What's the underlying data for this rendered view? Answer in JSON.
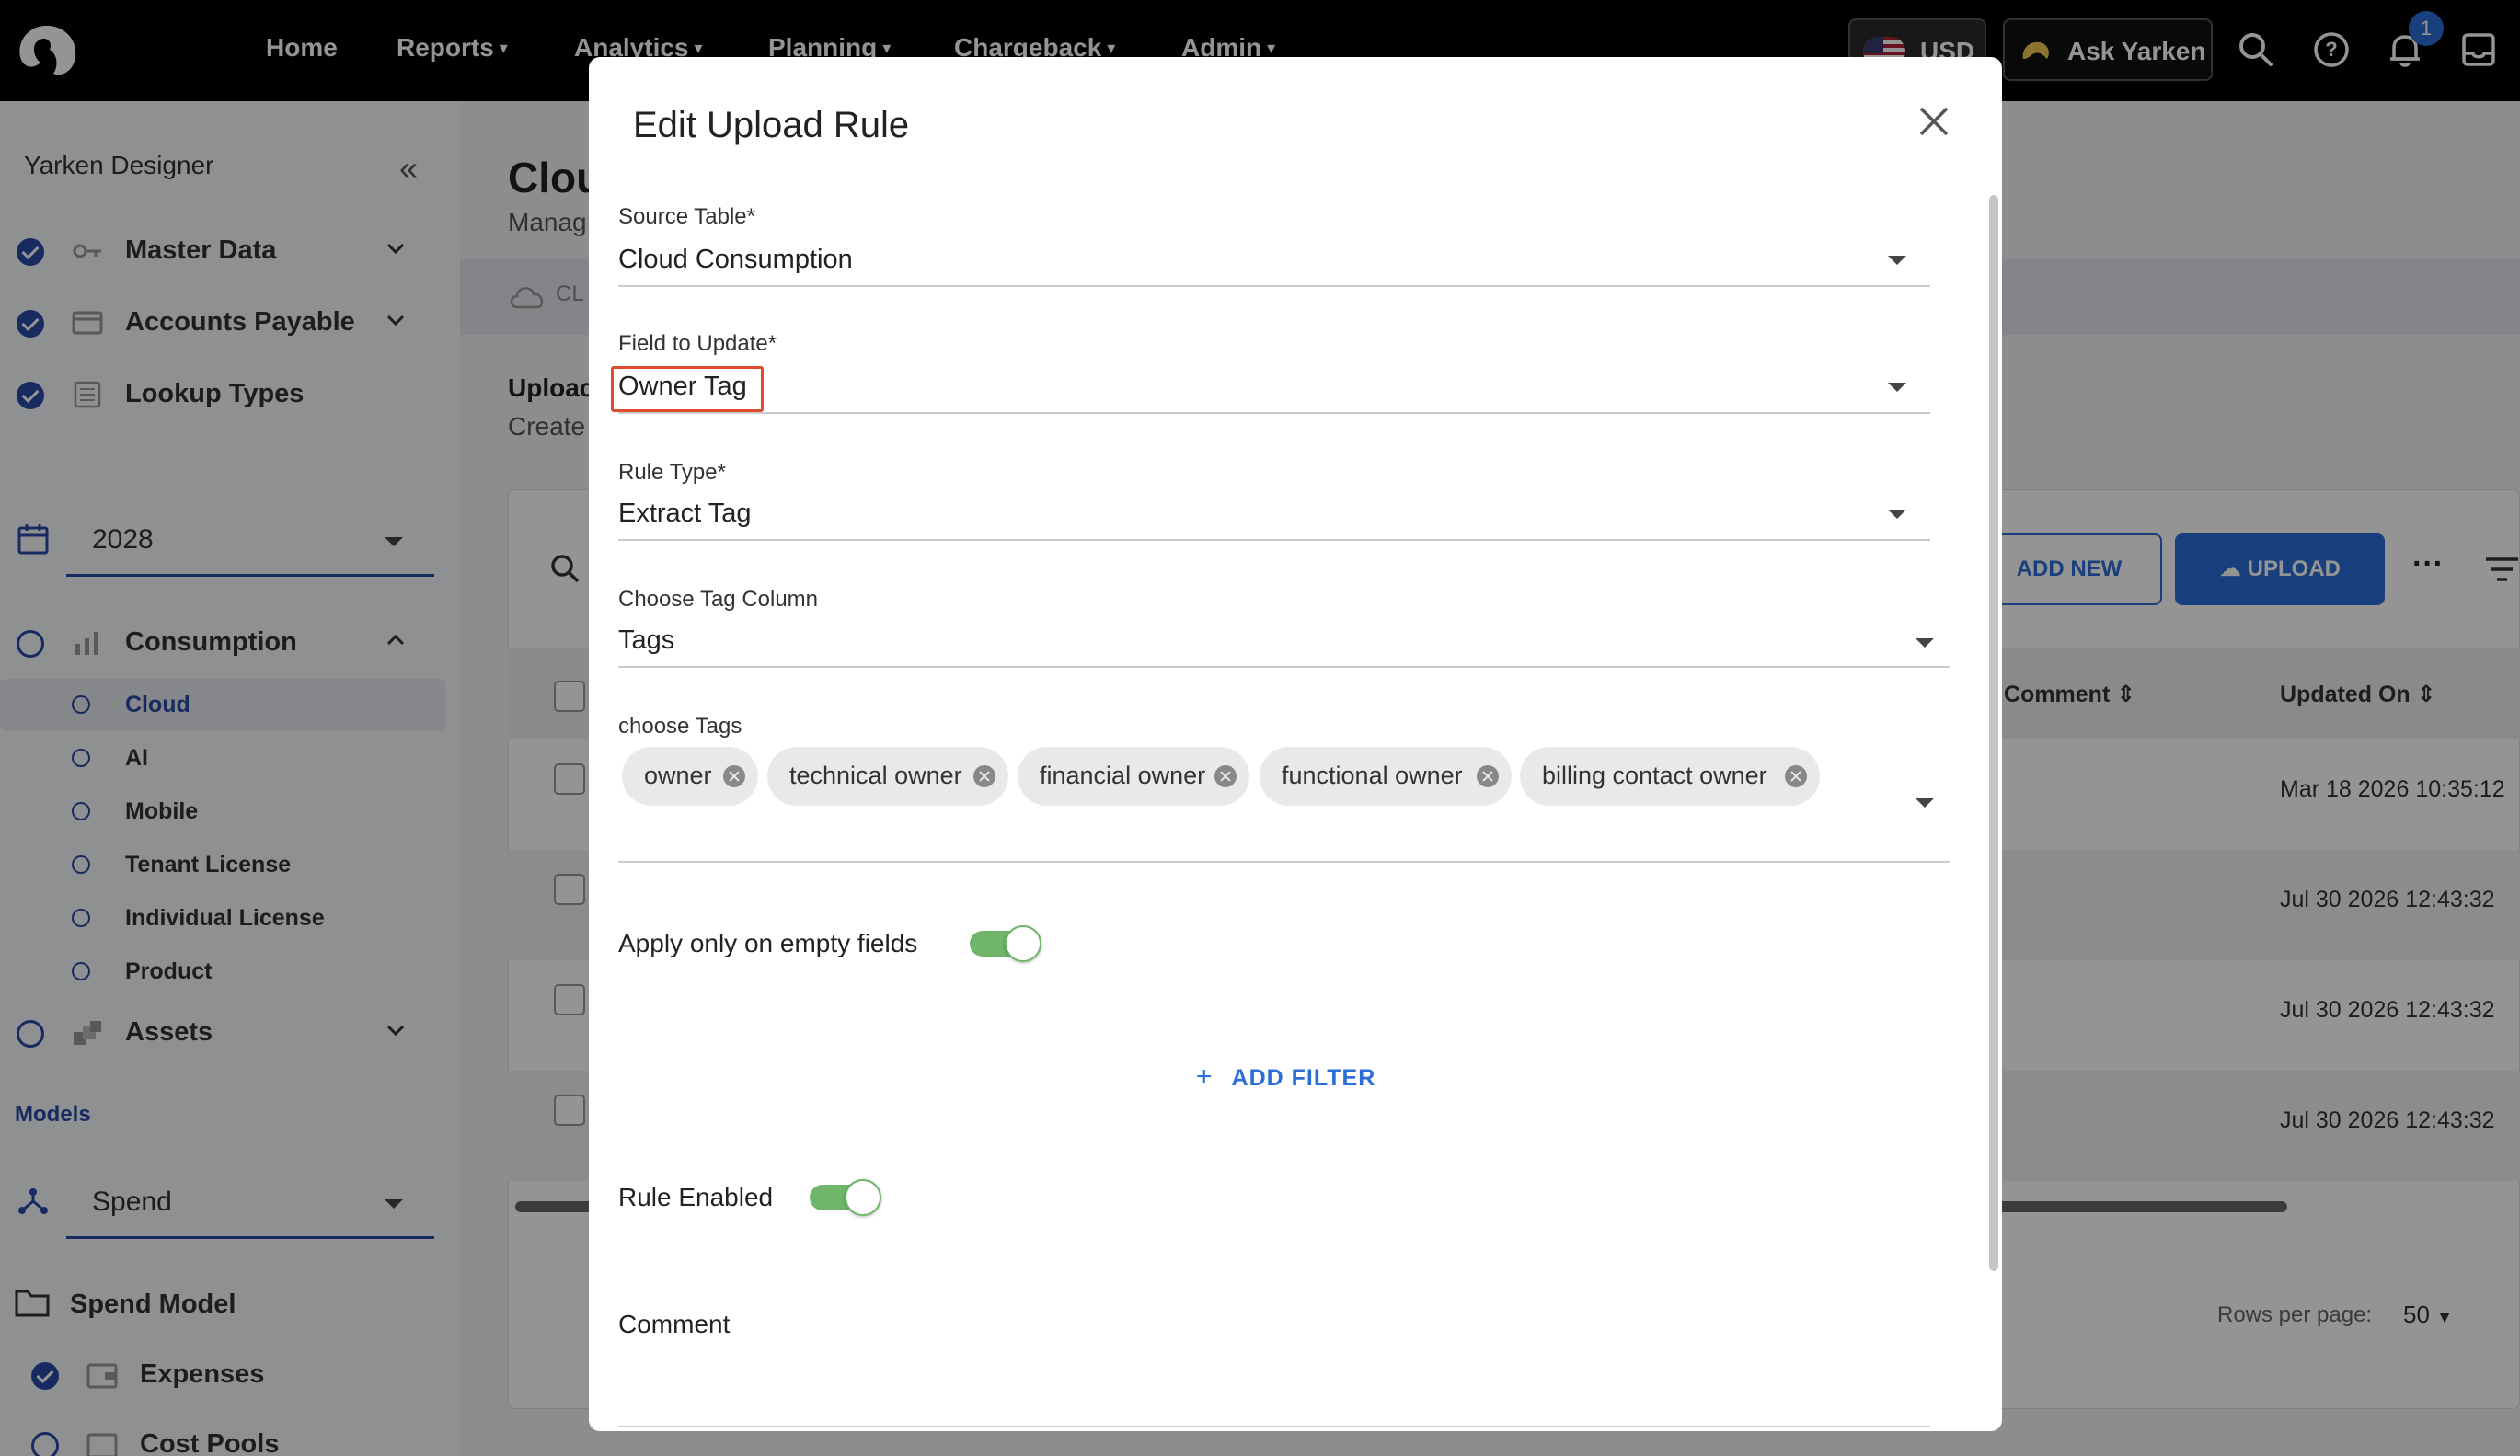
{
  "topnav": {
    "items": [
      {
        "label": "Home",
        "dropdown": false
      },
      {
        "label": "Reports",
        "dropdown": true
      },
      {
        "label": "Analytics",
        "dropdown": true
      },
      {
        "label": "Planning",
        "dropdown": true
      },
      {
        "label": "Chargeback",
        "dropdown": true
      },
      {
        "label": "Admin",
        "dropdown": true
      }
    ],
    "currency": "USD",
    "ask_label": "Ask Yarken",
    "notification_count": "1"
  },
  "sidebar": {
    "title": "Yarken Designer",
    "master_data": "Master Data",
    "accounts_payable": "Accounts Payable",
    "lookup_types": "Lookup Types",
    "year": "2028",
    "consumption": "Consumption",
    "consumption_items": [
      "Cloud",
      "AI",
      "Mobile",
      "Tenant License",
      "Individual License",
      "Product"
    ],
    "assets": "Assets",
    "models_label": "Models",
    "model_select": "Spend",
    "spend_model": "Spend Model",
    "expenses": "Expenses",
    "cost_pools": "Cost Pools"
  },
  "main": {
    "title": "Clou",
    "subtitle": "Manag",
    "tab": "CL",
    "section_title": "Uploac",
    "section_sub": "Create",
    "add_new": "ADD NEW",
    "upload": "UPLOAD",
    "col_comment": "Comment",
    "col_updated": "Updated On",
    "rows": [
      "Mar 18 2026 10:35:12",
      "Jul 30 2026 12:43:32",
      "Jul 30 2026 12:43:32",
      "Jul 30 2026 12:43:32"
    ],
    "rows_per_page_label": "Rows per page:",
    "rows_per_page": "50"
  },
  "modal": {
    "title": "Edit Upload Rule",
    "source_table_label": "Source Table",
    "source_table_value": "Cloud Consumption",
    "field_label": "Field to Update",
    "field_value": "Owner Tag",
    "rule_type_label": "Rule Type",
    "rule_type_value": "Extract Tag",
    "tag_column_label": "Choose Tag Column",
    "tag_column_value": "Tags",
    "tags_label": "choose Tags",
    "tags": [
      "owner",
      "technical owner",
      "financial owner",
      "functional owner",
      "billing contact owner"
    ],
    "apply_empty_label": "Apply only on empty fields",
    "apply_empty_on": true,
    "add_filter": "ADD FILTER",
    "rule_enabled_label": "Rule Enabled",
    "rule_enabled_on": true,
    "comment_label": "Comment",
    "required_mark": "*"
  },
  "colors": {
    "accent": "#2b6fd6",
    "nav_bg": "#000000",
    "toggle_on": "#6fb56a",
    "highlight": "#e04a2f",
    "sidebar_check": "#2a4aa8"
  }
}
